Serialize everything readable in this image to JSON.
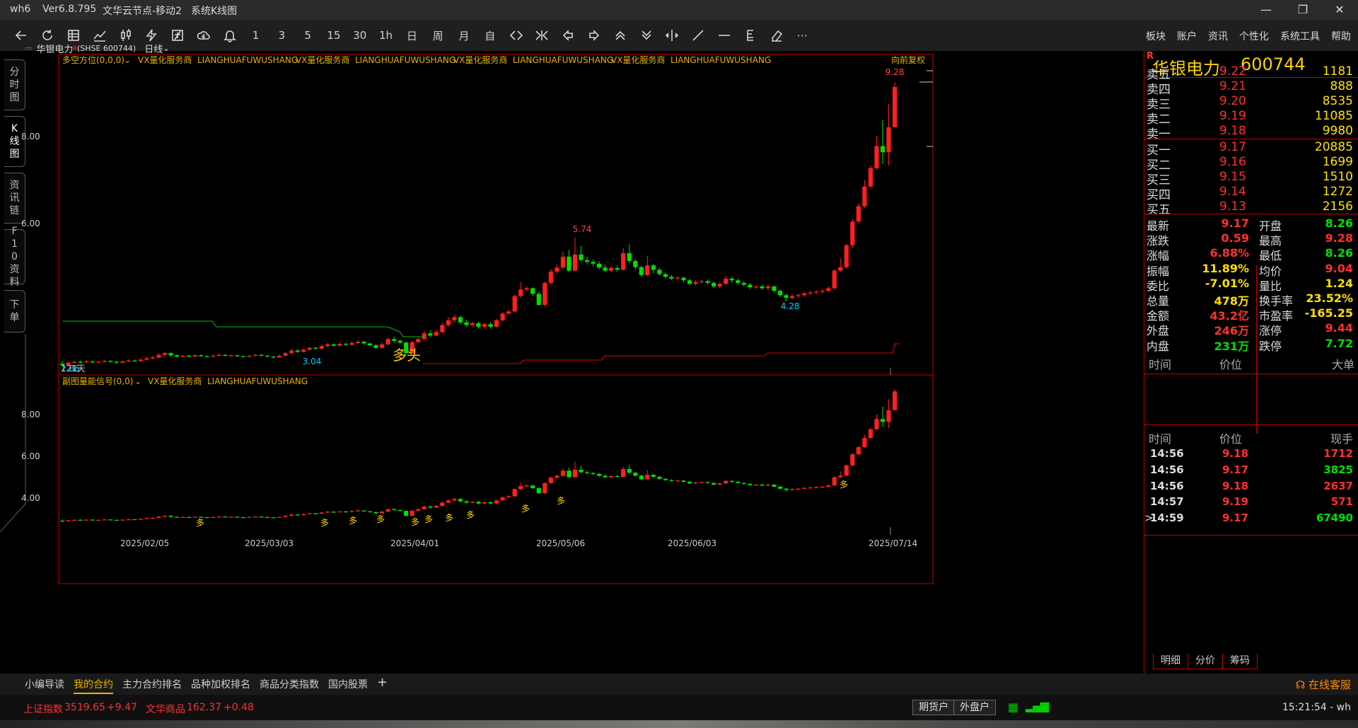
{
  "window": {
    "title": "wh6",
    "version": "Ver6.8.795",
    "server": "文华云节点-移动2",
    "view": "系统K线图"
  },
  "colors": {
    "up": "#ff2020",
    "down": "#00e000",
    "accent": "#ffd000",
    "border": "#c40000"
  },
  "toolbar": {
    "icons": [
      "back-arrow-icon",
      "refresh-icon",
      "table-icon",
      "line-chart-icon",
      "kline-icon",
      "lightning-icon",
      "screen-icon",
      "cloud-icon",
      "bell-icon"
    ],
    "periods": [
      "1",
      "3",
      "5",
      "15",
      "30",
      "1h",
      "日",
      "周",
      "月",
      "自"
    ],
    "nav_icons": [
      "expand-icon",
      "shrink-icon",
      "step-left-icon",
      "step-right-icon",
      "zoom-in-icon",
      "zoom-out-icon",
      "crosshair-icon",
      "draw-line-icon",
      "hline-icon",
      "text-tool-icon",
      "eraser-icon",
      "more-icon"
    ],
    "menu": [
      "板块",
      "账户",
      "资讯",
      "个性化",
      "系统工具",
      "帮助"
    ]
  },
  "left_tabs": [
    "分时图",
    "K线图",
    "资讯链",
    "F10资料",
    "下单"
  ],
  "chart": {
    "header": {
      "symbol": "华银电力",
      "symbol_mark": "R",
      "code": "(SHSE 600744)",
      "period": "日线"
    },
    "main_indicator": {
      "name": "多空方位(0,0,0)",
      "tags": [
        "VX量化服务商",
        "LIANGHUAFUWUSHANG",
        "VX量化服务商",
        "LIANGHUAFUWUSHANG",
        "VX量化服务商",
        "LIANGHUAFUWUSHANG",
        "VX量化服务商",
        "LIANGHUAFUWUSHANG"
      ],
      "adjust": "向前复权"
    },
    "sub_indicator": {
      "name": "副图量能信号(0,0)",
      "tags": [
        "VX量化服务商",
        "LIANGHUAFUWUSHANG"
      ]
    },
    "main_y_labels": [
      "8.00",
      "6.00"
    ],
    "sub_y_labels": [
      "8.00",
      "6.00",
      "4.00"
    ],
    "x_labels": [
      "2025/02/05",
      "2025/03/03",
      "2025/04/01",
      "2025/05/06",
      "2025/06/03",
      "2025/07/14"
    ],
    "annotations": {
      "high_max": "9.28",
      "high_mid": "5.74",
      "low_a": "3.04",
      "low_b": "4.28",
      "start": "2.86",
      "days": "121天",
      "signal_big": "多头",
      "signal_small": "多"
    }
  },
  "chart_data": {
    "type": "candlestick",
    "ylim": [
      2.6,
      9.6
    ],
    "candles": [
      [
        2.86,
        2.83,
        2.92,
        2.8
      ],
      [
        2.83,
        2.88,
        2.91,
        2.81
      ],
      [
        2.88,
        2.9,
        2.93,
        2.86
      ],
      [
        2.9,
        2.89,
        2.93,
        2.86
      ],
      [
        2.89,
        2.91,
        2.94,
        2.87
      ],
      [
        2.91,
        2.89,
        2.93,
        2.87
      ],
      [
        2.89,
        2.9,
        2.92,
        2.87
      ],
      [
        2.9,
        2.92,
        2.95,
        2.88
      ],
      [
        2.92,
        2.9,
        2.94,
        2.88
      ],
      [
        2.9,
        2.88,
        2.92,
        2.86
      ],
      [
        2.88,
        2.91,
        2.93,
        2.87
      ],
      [
        2.91,
        2.93,
        2.96,
        2.89
      ],
      [
        2.93,
        2.92,
        2.95,
        2.9
      ],
      [
        2.92,
        2.95,
        2.98,
        2.9
      ],
      [
        2.95,
        2.98,
        3.02,
        2.93
      ],
      [
        2.98,
        3.0,
        3.04,
        2.95
      ],
      [
        3.0,
        3.06,
        3.1,
        2.98
      ],
      [
        3.06,
        3.1,
        3.13,
        3.03
      ],
      [
        3.1,
        3.05,
        3.12,
        3.02
      ],
      [
        3.05,
        3.02,
        3.07,
        3.0
      ],
      [
        3.02,
        3.04,
        3.06,
        3.0
      ],
      [
        3.04,
        3.02,
        3.06,
        3.0
      ],
      [
        3.02,
        3.05,
        3.07,
        3.01
      ],
      [
        3.05,
        3.03,
        3.07,
        3.01
      ],
      [
        3.03,
        3.02,
        3.05,
        3.0
      ],
      [
        3.02,
        3.04,
        3.07,
        3.0
      ],
      [
        3.04,
        3.06,
        3.09,
        3.02
      ],
      [
        3.06,
        3.04,
        3.08,
        3.02
      ],
      [
        3.04,
        3.05,
        3.07,
        3.02
      ],
      [
        3.05,
        3.03,
        3.07,
        3.01
      ],
      [
        3.03,
        3.02,
        3.05,
        3.0
      ],
      [
        3.02,
        3.04,
        3.06,
        3.0
      ],
      [
        3.04,
        3.06,
        3.08,
        3.02
      ],
      [
        3.06,
        3.04,
        3.08,
        3.02
      ],
      [
        3.04,
        3.02,
        3.06,
        3.0
      ],
      [
        3.02,
        3.0,
        3.04,
        2.98
      ],
      [
        3.0,
        3.04,
        3.06,
        2.99
      ],
      [
        3.04,
        3.1,
        3.13,
        3.02
      ],
      [
        3.1,
        3.16,
        3.2,
        3.07
      ],
      [
        3.16,
        3.13,
        3.19,
        3.1
      ],
      [
        3.13,
        3.18,
        3.21,
        3.11
      ],
      [
        3.18,
        3.22,
        3.25,
        3.15
      ],
      [
        3.22,
        3.2,
        3.24,
        3.17
      ],
      [
        3.2,
        3.26,
        3.3,
        3.18
      ],
      [
        3.26,
        3.3,
        3.34,
        3.23
      ],
      [
        3.3,
        3.27,
        3.32,
        3.24
      ],
      [
        3.27,
        3.31,
        3.35,
        3.25
      ],
      [
        3.31,
        3.29,
        3.34,
        3.26
      ],
      [
        3.29,
        3.33,
        3.37,
        3.27
      ],
      [
        3.33,
        3.36,
        3.4,
        3.3
      ],
      [
        3.36,
        3.32,
        3.38,
        3.29
      ],
      [
        3.32,
        3.28,
        3.34,
        3.25
      ],
      [
        3.28,
        3.22,
        3.3,
        3.19
      ],
      [
        3.22,
        3.3,
        3.34,
        3.2
      ],
      [
        3.3,
        3.42,
        3.46,
        3.28
      ],
      [
        3.42,
        3.38,
        3.48,
        3.34
      ],
      [
        3.38,
        3.34,
        3.42,
        3.3
      ],
      [
        3.34,
        3.1,
        3.36,
        3.06
      ],
      [
        3.1,
        3.35,
        3.38,
        3.08
      ],
      [
        3.35,
        3.42,
        3.46,
        3.32
      ],
      [
        3.42,
        3.55,
        3.6,
        3.4
      ],
      [
        3.55,
        3.5,
        3.62,
        3.46
      ],
      [
        3.5,
        3.58,
        3.63,
        3.48
      ],
      [
        3.58,
        3.74,
        3.8,
        3.55
      ],
      [
        3.74,
        3.85,
        3.92,
        3.7
      ],
      [
        3.85,
        3.92,
        3.98,
        3.8
      ],
      [
        3.92,
        3.8,
        3.96,
        3.76
      ],
      [
        3.8,
        3.74,
        3.86,
        3.7
      ],
      [
        3.74,
        3.78,
        3.82,
        3.7
      ],
      [
        3.78,
        3.7,
        3.82,
        3.66
      ],
      [
        3.7,
        3.76,
        3.8,
        3.66
      ],
      [
        3.76,
        3.7,
        3.8,
        3.66
      ],
      [
        3.7,
        3.85,
        3.88,
        3.68
      ],
      [
        3.85,
        4.0,
        4.04,
        3.82
      ],
      [
        4.0,
        4.05,
        4.1,
        3.98
      ],
      [
        4.05,
        4.4,
        4.44,
        4.02
      ],
      [
        4.4,
        4.55,
        4.72,
        4.36
      ],
      [
        4.55,
        4.58,
        4.62,
        4.5
      ],
      [
        4.58,
        4.45,
        4.6,
        4.4
      ],
      [
        4.45,
        4.2,
        4.5,
        4.18
      ],
      [
        4.2,
        4.7,
        4.74,
        4.15
      ],
      [
        4.7,
        4.96,
        5.02,
        4.65
      ],
      [
        4.96,
        5.05,
        5.12,
        4.9
      ],
      [
        5.05,
        5.3,
        5.42,
        5.0
      ],
      [
        5.3,
        4.98,
        5.45,
        4.95
      ],
      [
        4.98,
        5.35,
        5.74,
        4.95
      ],
      [
        5.35,
        5.22,
        5.54,
        5.18
      ],
      [
        5.22,
        5.18,
        5.3,
        5.12
      ],
      [
        5.18,
        5.14,
        5.24,
        5.08
      ],
      [
        5.14,
        5.05,
        5.2,
        5.0
      ],
      [
        5.05,
        4.98,
        5.12,
        4.95
      ],
      [
        4.98,
        5.04,
        5.08,
        4.94
      ],
      [
        5.04,
        5.0,
        5.1,
        4.95
      ],
      [
        5.0,
        5.38,
        5.5,
        4.98
      ],
      [
        5.38,
        5.2,
        5.58,
        5.15
      ],
      [
        5.2,
        5.06,
        5.25,
        5.0
      ],
      [
        5.06,
        4.88,
        5.1,
        4.84
      ],
      [
        4.88,
        5.1,
        5.32,
        4.86
      ],
      [
        5.1,
        5.0,
        5.14,
        4.92
      ],
      [
        5.0,
        4.9,
        5.05,
        4.86
      ],
      [
        4.9,
        4.84,
        4.94,
        4.8
      ],
      [
        4.84,
        4.8,
        4.88,
        4.76
      ],
      [
        4.8,
        4.82,
        4.85,
        4.76
      ],
      [
        4.82,
        4.76,
        4.84,
        4.72
      ],
      [
        4.76,
        4.68,
        4.8,
        4.64
      ],
      [
        4.68,
        4.72,
        4.76,
        4.64
      ],
      [
        4.72,
        4.74,
        4.78,
        4.68
      ],
      [
        4.74,
        4.7,
        4.78,
        4.66
      ],
      [
        4.7,
        4.62,
        4.74,
        4.58
      ],
      [
        4.62,
        4.68,
        4.72,
        4.58
      ],
      [
        4.68,
        4.8,
        4.86,
        4.64
      ],
      [
        4.8,
        4.76,
        4.84,
        4.7
      ],
      [
        4.76,
        4.7,
        4.8,
        4.66
      ],
      [
        4.7,
        4.66,
        4.74,
        4.62
      ],
      [
        4.66,
        4.6,
        4.7,
        4.56
      ],
      [
        4.6,
        4.62,
        4.64,
        4.56
      ],
      [
        4.62,
        4.58,
        4.66,
        4.54
      ],
      [
        4.58,
        4.62,
        4.66,
        4.54
      ],
      [
        4.62,
        4.52,
        4.64,
        4.48
      ],
      [
        4.52,
        4.42,
        4.56,
        4.38
      ],
      [
        4.42,
        4.36,
        4.46,
        4.28
      ],
      [
        4.36,
        4.4,
        4.44,
        4.32
      ],
      [
        4.4,
        4.42,
        4.46,
        4.36
      ],
      [
        4.42,
        4.46,
        4.5,
        4.38
      ],
      [
        4.46,
        4.48,
        4.52,
        4.42
      ],
      [
        4.48,
        4.5,
        4.54,
        4.44
      ],
      [
        4.5,
        4.52,
        4.56,
        4.46
      ],
      [
        4.52,
        4.58,
        4.62,
        4.48
      ],
      [
        4.58,
        4.98,
        5.02,
        4.55
      ],
      [
        4.98,
        5.06,
        5.26,
        4.95
      ],
      [
        5.06,
        5.56,
        5.6,
        5.02
      ],
      [
        5.56,
        6.1,
        6.16,
        5.5
      ],
      [
        6.1,
        6.45,
        6.52,
        6.05
      ],
      [
        6.45,
        6.9,
        7.05,
        6.4
      ],
      [
        6.9,
        7.32,
        7.38,
        6.85
      ],
      [
        7.32,
        7.82,
        8.05,
        7.28
      ],
      [
        7.82,
        7.68,
        8.42,
        7.42
      ],
      [
        7.68,
        8.25,
        8.78,
        7.38
      ],
      [
        8.25,
        9.17,
        9.28,
        8.26
      ]
    ]
  },
  "quote": {
    "name": "华银电力",
    "code": "600744",
    "mark": "R",
    "asks": [
      {
        "label": "卖五",
        "price": "9.22",
        "vol": "1181"
      },
      {
        "label": "卖四",
        "price": "9.21",
        "vol": "888"
      },
      {
        "label": "卖三",
        "price": "9.20",
        "vol": "8535"
      },
      {
        "label": "卖二",
        "price": "9.19",
        "vol": "11085"
      },
      {
        "label": "卖一",
        "price": "9.18",
        "vol": "9980"
      }
    ],
    "bids": [
      {
        "label": "买一",
        "price": "9.17",
        "vol": "20885"
      },
      {
        "label": "买二",
        "price": "9.16",
        "vol": "1699"
      },
      {
        "label": "买三",
        "price": "9.15",
        "vol": "1510"
      },
      {
        "label": "买四",
        "price": "9.14",
        "vol": "1272"
      },
      {
        "label": "买五",
        "price": "9.13",
        "vol": "2156"
      }
    ],
    "stats": [
      {
        "k1": "最新",
        "v1": "9.17",
        "c1": "#ff3030",
        "k2": "开盘",
        "v2": "8.26",
        "c2": "#00e000"
      },
      {
        "k1": "涨跌",
        "v1": "0.59",
        "c1": "#ff3030",
        "k2": "最高",
        "v2": "9.28",
        "c2": "#ff3030"
      },
      {
        "k1": "涨幅",
        "v1": "6.88%",
        "c1": "#ff3030",
        "k2": "最低",
        "v2": "8.26",
        "c2": "#00e000"
      },
      {
        "k1": "振幅",
        "v1": "11.89%",
        "c1": "#ffe000",
        "k2": "均价",
        "v2": "9.04",
        "c2": "#ff3030"
      },
      {
        "k1": "委比",
        "v1": "-7.01%",
        "c1": "#ffe000",
        "k2": "量比",
        "v2": "1.24",
        "c2": "#ffe000"
      },
      {
        "k1": "总量",
        "v1": "478万",
        "c1": "#ffe000",
        "k2": "换手率",
        "v2": "23.52%",
        "c2": "#ffe000"
      },
      {
        "k1": "金额",
        "v1": "43.2亿",
        "c1": "#ff3030",
        "k2": "市盈率",
        "v2": "-165.25",
        "c2": "#ffe000"
      },
      {
        "k1": "外盘",
        "v1": "246万",
        "c1": "#ff3030",
        "k2": "涨停",
        "v2": "9.44",
        "c2": "#ff3030"
      },
      {
        "k1": "内盘",
        "v1": "231万",
        "c1": "#00e000",
        "k2": "跌停",
        "v2": "7.72",
        "c2": "#00e000"
      }
    ],
    "big_header": {
      "time": "时间",
      "price": "价位",
      "big": "大单"
    },
    "ticks_header": {
      "time": "时间",
      "price": "价位",
      "hand": "现手"
    },
    "ticks": [
      {
        "time": "14:56",
        "price": "9.18",
        "vol": "1712",
        "c": "#ff3030"
      },
      {
        "time": "14:56",
        "price": "9.17",
        "vol": "3825",
        "c": "#00e000"
      },
      {
        "time": "14:56",
        "price": "9.18",
        "vol": "2637",
        "c": "#ff3030"
      },
      {
        "time": "14:57",
        "price": "9.19",
        "vol": "571",
        "c": "#ff3030"
      },
      {
        "time": "14:59",
        "price": "9.17",
        "vol": "67490",
        "c": "#00e000",
        "mark": ">"
      }
    ],
    "bottom_tabs": [
      "明细",
      "分价",
      "筹码"
    ]
  },
  "tabs": [
    "小编导读",
    "我的合约",
    "主力合约排名",
    "品种加权排名",
    "商品分类指数",
    "国内股票",
    "+"
  ],
  "service": "在线客服",
  "status": {
    "idx1_name": "上证指数",
    "idx1_val": "3519.65",
    "idx1_chg": "+9.47",
    "idx2_name": "文华商品",
    "idx2_val": "162.37",
    "idx2_chg": "+0.48",
    "btn1": "期货户",
    "btn2": "外盘户",
    "clock": "15:21:54 - wh"
  }
}
